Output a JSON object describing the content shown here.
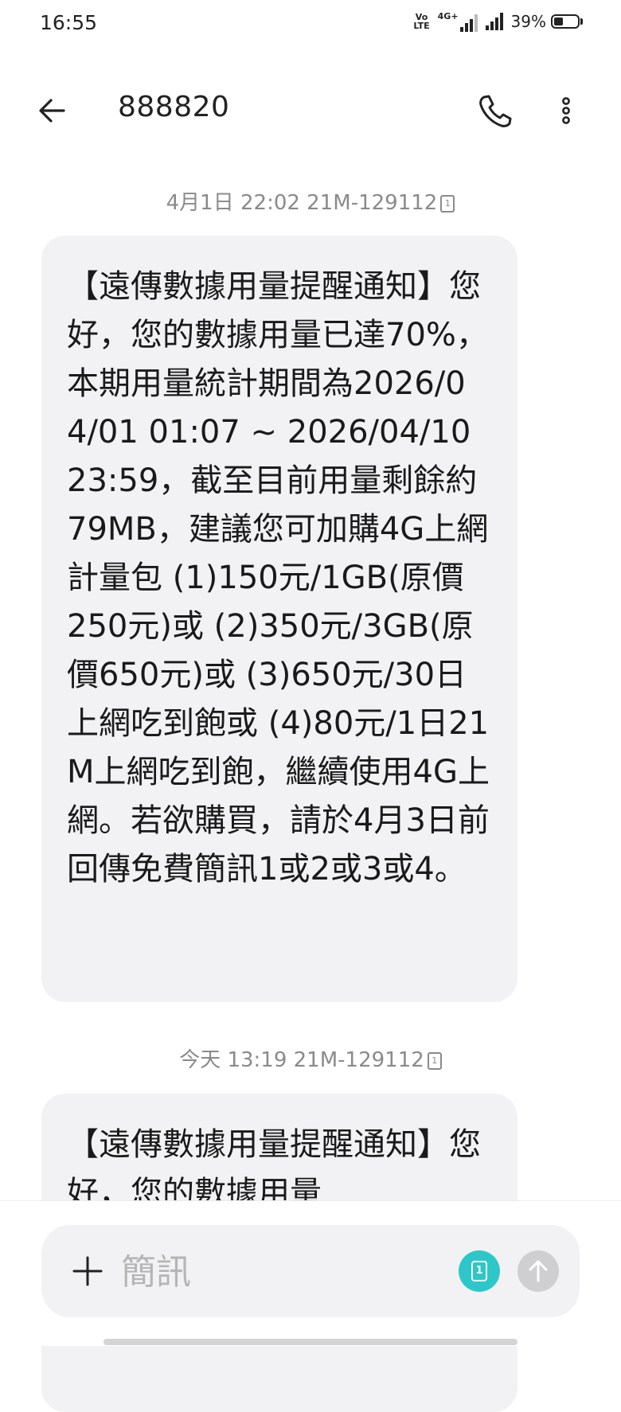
{
  "status_bar": {
    "time": "16:55",
    "volte_label": "VoLTE",
    "net_label": "4G+",
    "battery_percent": "39%",
    "battery_level": 0.39
  },
  "header": {
    "title": "888820",
    "back_icon": "arrow-left-icon",
    "call_icon": "phone-icon",
    "more_icon": "more-vertical-icon"
  },
  "messages": [
    {
      "meta": "4月1日 22:02 21M-129112",
      "sim_slot": "1",
      "body": "【遠傳數據用量提醒通知】您好，您的數據用量已達70%，本期用量統計期間為2026/04/01 01:07 ~ 2026/04/10 23:59，截至目前用量剩餘約79MB，建議您可加購4G上網計量包 (1)150元/1GB(原價 250元)或 (2)350元/3GB(原價650元)或 (3)650元/30日上網吃到飽或 (4)80元/1日21M上網吃到飽，繼續使用4G上網。若欲購買，請於4月3日前回傳免費簡訊1或2或3或4。"
    },
    {
      "meta": "今天 13:19 21M-129112",
      "sim_slot": "1",
      "body": "【遠傳數據用量提醒通知】您好，您的數據用量"
    }
  ],
  "composer": {
    "placeholder": "簡訊",
    "sim_slot": "1",
    "accent_color": "#2ec7c9"
  }
}
